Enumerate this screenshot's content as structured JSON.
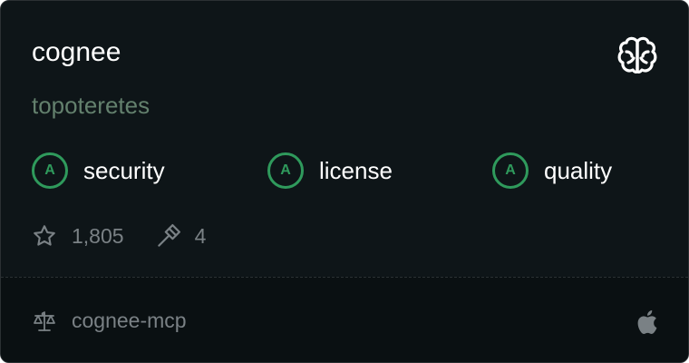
{
  "card": {
    "title": "cognee",
    "owner": "topoteretes",
    "icon": "brain-icon"
  },
  "grades": [
    {
      "grade": "A",
      "label": "security"
    },
    {
      "grade": "A",
      "label": "license"
    },
    {
      "grade": "A",
      "label": "quality"
    }
  ],
  "stats": {
    "stars": "1,805",
    "tools": "4"
  },
  "footer": {
    "package": "cognee-mcp",
    "platform_icon": "apple-icon"
  },
  "colors": {
    "background": "#0e1518",
    "footer_background": "#0a1012",
    "grade_green": "#2f9a5c",
    "owner_text": "#63806d",
    "muted_text": "#7a8185"
  }
}
